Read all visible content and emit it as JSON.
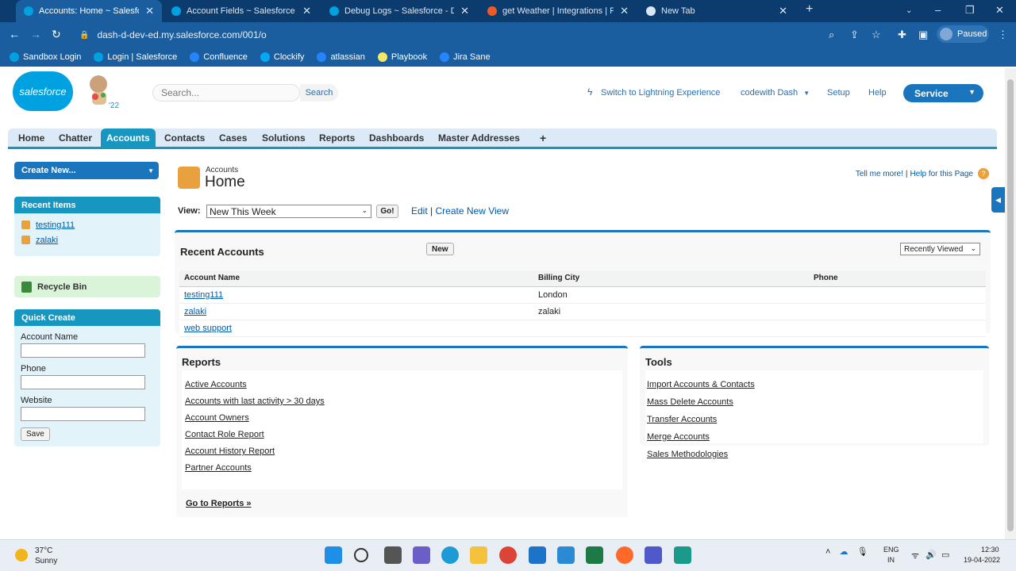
{
  "browser": {
    "tabs": [
      {
        "title": "Accounts: Home ~ Salesforce - D",
        "active": true,
        "favicon_color": "#00a1e0"
      },
      {
        "title": "Account Fields ~ Salesforce - De",
        "active": false,
        "favicon_color": "#00a1e0"
      },
      {
        "title": "Debug Logs ~ Salesforce - Devel",
        "active": false,
        "favicon_color": "#00a1e0"
      },
      {
        "title": "get Weather | Integrations | Postm",
        "active": false,
        "favicon_color": "#ef5b25"
      },
      {
        "title": "New Tab",
        "active": false,
        "favicon_color": "#dbe6f3"
      }
    ],
    "url": "dash-d-dev-ed.my.salesforce.com/001/o",
    "profile_status": "Paused",
    "bookmarks": [
      {
        "label": "Sandbox Login",
        "color": "#00a1e0"
      },
      {
        "label": "Login | Salesforce",
        "color": "#00a1e0"
      },
      {
        "label": "Confluence",
        "color": "#2684ff"
      },
      {
        "label": "Clockify",
        "color": "#03a9f4"
      },
      {
        "label": "atlassian",
        "color": "#2684ff"
      },
      {
        "label": "Playbook",
        "color": "#f5e663"
      },
      {
        "label": "Jira Sane",
        "color": "#2684ff"
      }
    ]
  },
  "sf": {
    "logo_text": "salesforce",
    "mascot_badge": "'22",
    "search_placeholder": "Search...",
    "search_button": "Search",
    "lightning_link": "Switch to Lightning Experience",
    "user_menu": "codewith Dash",
    "setup_link": "Setup",
    "help_link": "Help",
    "app_menu": "Service",
    "tabs": [
      "Home",
      "Chatter",
      "Accounts",
      "Contacts",
      "Cases",
      "Solutions",
      "Reports",
      "Dashboards",
      "Master Addresses",
      "+"
    ],
    "active_tab": "Accounts",
    "sidebar": {
      "create_new": "Create New...",
      "recent_items_title": "Recent Items",
      "recent_items": [
        "testing111",
        "zalaki"
      ],
      "recycle_bin": "Recycle Bin",
      "quick_create_title": "Quick Create",
      "qc_account_name_label": "Account Name",
      "qc_phone_label": "Phone",
      "qc_website_label": "Website",
      "qc_save": "Save"
    },
    "main": {
      "object_label": "Accounts",
      "page_title": "Home",
      "tell_me_more": "Tell me more!",
      "separator": "|",
      "help_for_page": "Help for this Page",
      "view_label": "View:",
      "view_selected": "New This Week",
      "go_button": "Go!",
      "edit_link": "Edit",
      "create_view_link": "Create New View",
      "recent_title": "Recent Accounts",
      "new_button": "New",
      "recently_viewed": "Recently Viewed",
      "columns": [
        "Account Name",
        "Billing City",
        "Phone"
      ],
      "rows": [
        [
          "testing111",
          "London",
          ""
        ],
        [
          "zalaki",
          "zalaki",
          ""
        ],
        [
          "web support",
          "",
          ""
        ]
      ],
      "reports_title": "Reports",
      "reports": [
        "Active Accounts",
        "Accounts with last activity > 30 days",
        "Account Owners",
        "Contact Role Report",
        "Account History Report",
        "Partner Accounts"
      ],
      "goto_reports": "Go to Reports »",
      "tools_title": "Tools",
      "tools": [
        "Import Accounts & Contacts",
        "Mass Delete Accounts",
        "Transfer Accounts",
        "Merge Accounts",
        "Sales Methodologies"
      ]
    }
  },
  "taskbar": {
    "temperature": "37°C",
    "weather": "Sunny",
    "lang_line1": "ENG",
    "lang_line2": "IN",
    "time": "12:30",
    "date": "19-04-2022"
  }
}
